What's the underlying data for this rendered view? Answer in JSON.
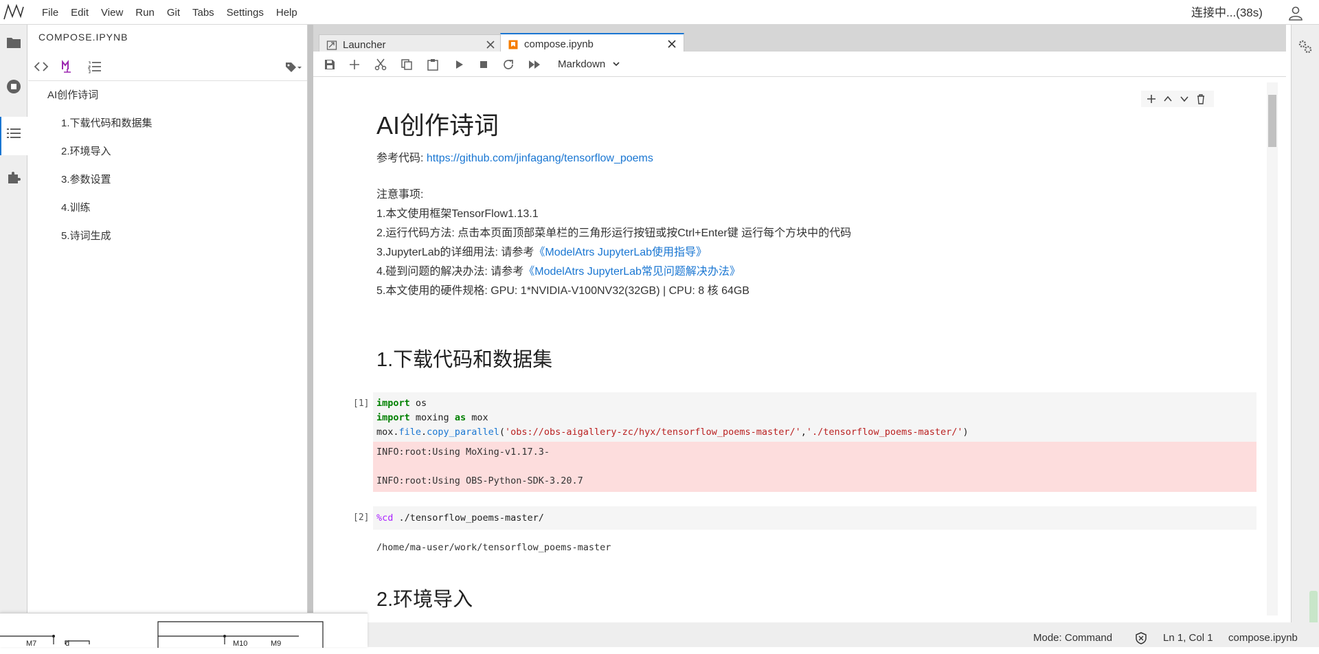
{
  "menubar": {
    "items": [
      "File",
      "Edit",
      "View",
      "Run",
      "Git",
      "Tabs",
      "Settings",
      "Help"
    ],
    "connection_status": "连接中...(38s)"
  },
  "sidepanel": {
    "title": "COMPOSE.IPYNB",
    "toc": [
      {
        "label": "AI创作诗词",
        "level": 1
      },
      {
        "label": "1.下载代码和数据集",
        "level": 2
      },
      {
        "label": "2.环境导入",
        "level": 2
      },
      {
        "label": "3.参数设置",
        "level": 2
      },
      {
        "label": "4.训练",
        "level": 2
      },
      {
        "label": "5.诗词生成",
        "level": 2
      }
    ]
  },
  "tabs": [
    {
      "label": "Launcher",
      "active": false
    },
    {
      "label": "compose.ipynb",
      "active": true
    }
  ],
  "toolbar": {
    "cell_type": "Markdown"
  },
  "notebook": {
    "title": "AI创作诗词",
    "ref_label": "参考代码: ",
    "ref_link": "https://github.com/jinfagang/tensorflow_poems",
    "notes_title": "注意事项:",
    "note1": "1.本文使用框架TensorFlow1.13.1",
    "note2": "2.运行代码方法: 点击本页面顶部菜单栏的三角形运行按钮或按Ctrl+Enter键 运行每个方块中的代码",
    "note3_prefix": "3.JupyterLab的详细用法: 请参考",
    "note3_link": "《ModelAtrs JupyterLab使用指导》",
    "note4_prefix": "4.碰到问题的解决办法: 请参考",
    "note4_link": "《ModelAtrs JupyterLab常见问题解决办法》",
    "note5": "5.本文使用的硬件规格: GPU: 1*NVIDIA-V100NV32(32GB) | CPU: 8 核 64GB",
    "section1": "1.下载代码和数据集",
    "cell1_prompt": "[1]",
    "cell1_line3_obj": "mox.",
    "cell1_line3_str1": "'obs://obs-aigallery-zc/hyx/tensorflow_poems-master/'",
    "cell1_line3_str2": "'./tensorflow_poems-master/'",
    "cell1_stderr": "INFO:root:Using MoXing-v1.17.3-\n\nINFO:root:Using OBS-Python-SDK-3.20.7",
    "cell2_prompt": "[2]",
    "cell2_code": "./tensorflow_poems-master/",
    "cell2_magic": "%cd",
    "cell2_output": "/home/ma-user/work/tensorflow_poems-master",
    "section2": "2.环境导入"
  },
  "statusbar": {
    "mode": "Mode: Command",
    "position": "Ln 1, Col 1",
    "filename": "compose.ipynb"
  },
  "overlay": {
    "labels": [
      "M7",
      "M10",
      "M9"
    ]
  },
  "colors": {
    "accent": "#1976d2",
    "markdown_icon": "#9c27b0",
    "notebook_icon": "#f57c00",
    "stderr_bg": "#fddddd"
  }
}
